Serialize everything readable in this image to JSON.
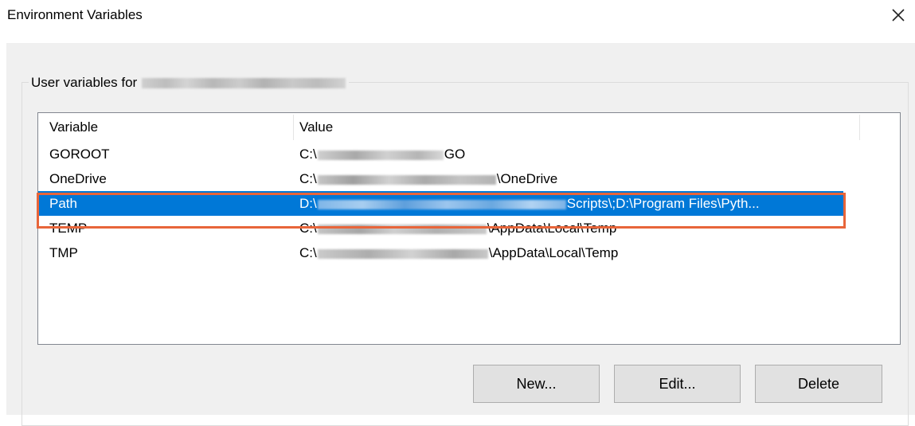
{
  "window": {
    "title": "Environment Variables"
  },
  "user_group": {
    "legend": "User variables for"
  },
  "table": {
    "columns": [
      "Variable",
      "Value"
    ],
    "rows": [
      {
        "name": "GOROOT",
        "prefix": "C:\\",
        "suffix": "GO"
      },
      {
        "name": "OneDrive",
        "prefix": "C:\\",
        "suffix": "\\OneDrive"
      },
      {
        "name": "Path",
        "prefix": "D:\\",
        "suffix": "Scripts\\;D:\\Program Files\\Pyth..."
      },
      {
        "name": "TEMP",
        "prefix": "C:\\",
        "suffix": "\\AppData\\Local\\Temp"
      },
      {
        "name": "TMP",
        "prefix": "C:\\",
        "suffix": "\\AppData\\Local\\Temp"
      }
    ],
    "selected_index": 2
  },
  "buttons": {
    "new": "New...",
    "edit": "Edit...",
    "delete": "Delete"
  },
  "colors": {
    "selection": "#0078d7",
    "highlight_border": "#e8653a",
    "client_bg": "#f0f0f0"
  },
  "icons": {
    "close": "close-icon"
  }
}
